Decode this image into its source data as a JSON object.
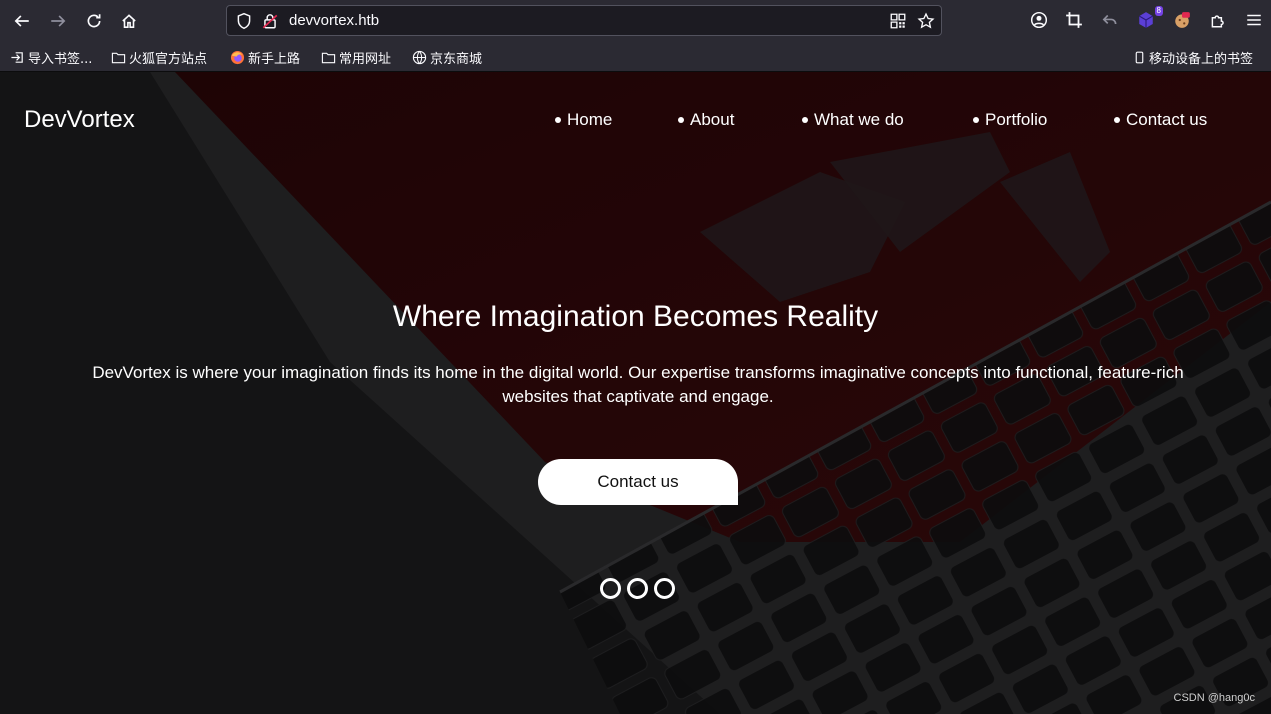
{
  "browser": {
    "url": "devvortex.htb",
    "extension_badge": "8",
    "bookmarks": [
      {
        "label": "导入书签...",
        "icon": "import-icon"
      },
      {
        "label": "火狐官方站点",
        "icon": "folder-icon"
      },
      {
        "label": "新手上路",
        "icon": "firefox-icon"
      },
      {
        "label": "常用网址",
        "icon": "folder-icon"
      },
      {
        "label": "京东商城",
        "icon": "globe-icon"
      }
    ],
    "mobile_bookmarks": "移动设备上的书签"
  },
  "site": {
    "brand": "DevVortex",
    "nav": [
      "Home",
      "About",
      "What we do",
      "Portfolio",
      "Contact us"
    ],
    "hero_title": "Where Imagination Becomes Reality",
    "hero_text": "DevVortex is where your imagination finds its home in the digital world. Our expertise transforms imaginative concepts into functional, feature-rich websites that captivate and engage.",
    "cta_label": "Contact us",
    "carousel_slides": 3
  },
  "watermark": "CSDN @hang0c",
  "colors": {
    "chrome": "#2b2a33",
    "urlbar": "#1c1b22",
    "accent_red": "#3a0a0c"
  }
}
